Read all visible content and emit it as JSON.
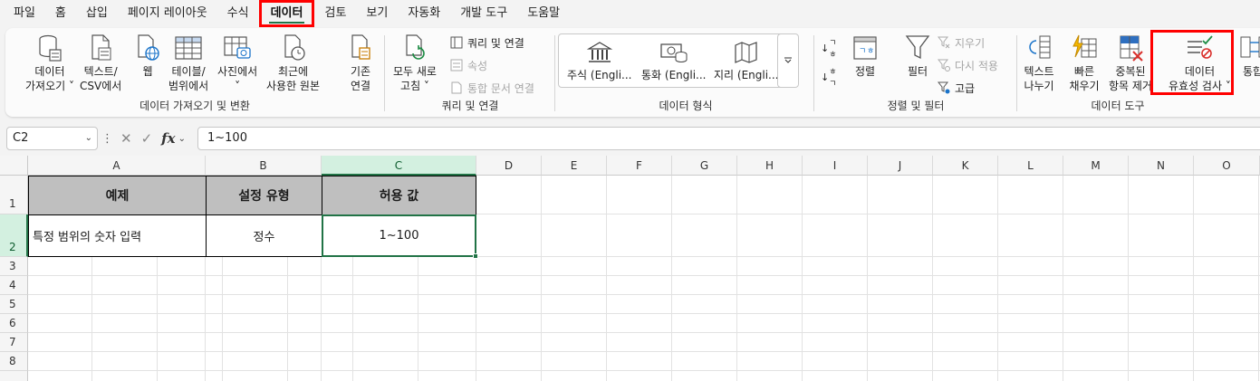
{
  "menu": {
    "tabs": [
      "파일",
      "홈",
      "삽입",
      "페이지 레이아웃",
      "수식",
      "데이터",
      "검토",
      "보기",
      "자동화",
      "개발 도구",
      "도움말"
    ],
    "active_index": 5
  },
  "ribbon": {
    "get_data": {
      "label": "데이터 가져오기 및 변환",
      "get_data_line1": "데이터",
      "get_data_line2": "가져오기 ˅",
      "text_csv_line1": "텍스트/",
      "text_csv_line2": "CSV에서",
      "web": "웹",
      "table_line1": "테이블/",
      "table_line2": "범위에서",
      "picture_line1": "사진에서",
      "picture_line2": "˅",
      "recent_line1": "최근에",
      "recent_line2": "사용한 원본",
      "existing_line1": "기존",
      "existing_line2": "연결"
    },
    "queries": {
      "label": "쿼리 및 연결",
      "refresh_line1": "모두 새로",
      "refresh_line2": "고침 ˅",
      "queries_connections": "쿼리 및 연결",
      "properties": "속성",
      "edit_links": "통합 문서 연결"
    },
    "data_types": {
      "label": "데이터 형식",
      "stocks": "주식 (Engli...",
      "currencies": "통화 (Engli...",
      "geography": "지리 (Engli..."
    },
    "sort_filter": {
      "label": "정렬 및 필터",
      "sort": "정렬",
      "filter": "필터",
      "clear": "지우기",
      "reapply": "다시 적용",
      "advanced": "고급"
    },
    "data_tools": {
      "label": "데이터 도구",
      "text_to_columns_line1": "텍스트",
      "text_to_columns_line2": "나누기",
      "flash_fill_line1": "빠른",
      "flash_fill_line2": "채우기",
      "remove_dup_line1": "중복된",
      "remove_dup_line2": "항목 제거",
      "validation_line1": "데이터",
      "validation_line2": "유효성 검사 ˅",
      "consolidate": "통합"
    }
  },
  "formula_bar": {
    "name_box": "C2",
    "formula": "1~100"
  },
  "sheet": {
    "columns": [
      "A",
      "B",
      "C",
      "D",
      "E",
      "F",
      "G",
      "H",
      "I",
      "J",
      "K",
      "L",
      "M",
      "N",
      "O"
    ],
    "rows": [
      "1",
      "2",
      "3",
      "4",
      "5",
      "6",
      "7",
      "8"
    ],
    "selected_column": "C",
    "selected_row": "2",
    "headers": [
      "예제",
      "설정 유형",
      "허용 값"
    ],
    "row2": [
      "특정 범위의 숫자 입력",
      "정수",
      "1~100"
    ]
  },
  "colors": {
    "accent": "#217346",
    "highlight": "#ff0000",
    "table_header_fill": "#bfbfbf"
  }
}
